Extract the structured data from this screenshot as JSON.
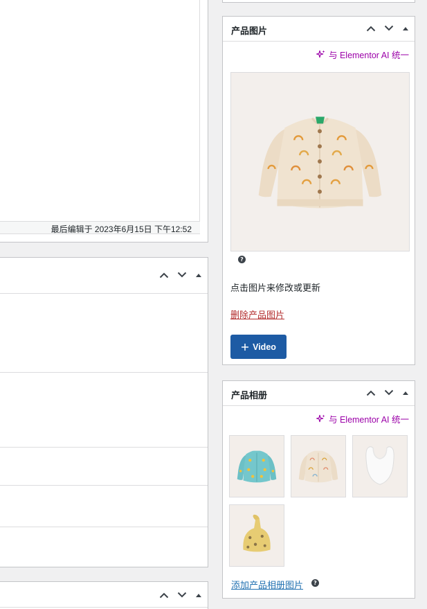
{
  "editor": {
    "last_edited": "最后编辑于 2023年6月15日 下午12:52"
  },
  "product_image_box": {
    "title": "产品图片",
    "ai_label": "与 Elementor AI 统一",
    "hint": "点击图片来修改或更新",
    "remove_label": "删除产品图片",
    "video_label": "Video",
    "help_icon": "question-icon"
  },
  "gallery_box": {
    "title": "产品相册",
    "ai_label": "与 Elementor AI 统一",
    "add_label": "添加产品相册图片",
    "images": [
      "blue-cardigan",
      "cream-cardigan",
      "white-bib",
      "yellow-hat"
    ]
  },
  "colors": {
    "accent_blue": "#2271b1",
    "button_blue": "#1d5ba4",
    "danger_red": "#b32d2e",
    "ai_purple": "#9b00a8"
  },
  "icons": {
    "up": "chevron-up-icon",
    "down": "chevron-down-icon",
    "toggle": "triangle-up-icon",
    "sparkle": "sparkle-icon",
    "plus": "plus-icon"
  }
}
